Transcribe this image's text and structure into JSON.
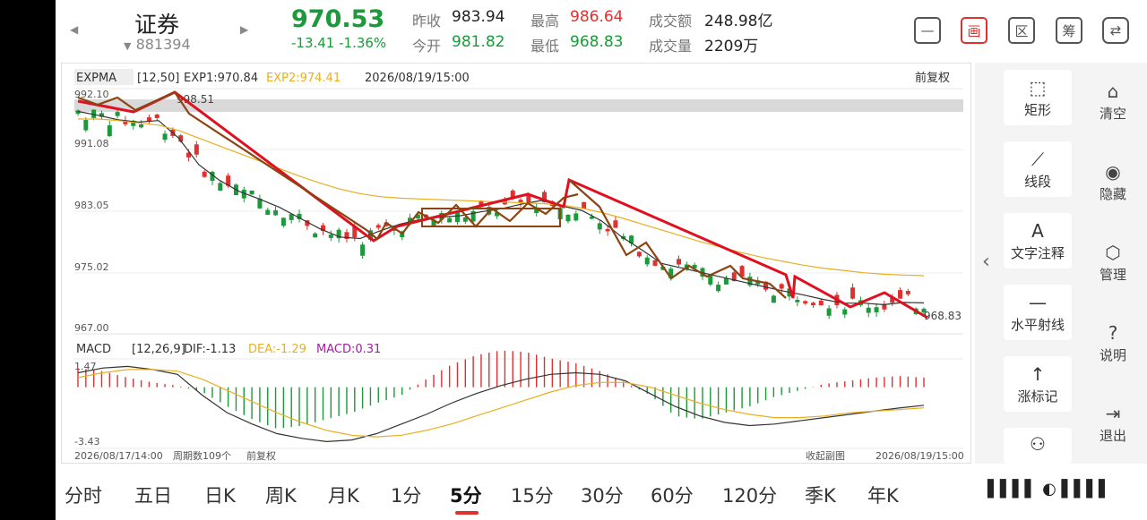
{
  "header": {
    "name": "证券",
    "code": "881394",
    "price": "970.53",
    "change": "-13.41  -1.36%",
    "quotes": [
      {
        "label": "昨收",
        "value": "983.94"
      },
      {
        "label": "今开",
        "value": "981.82"
      },
      {
        "label": "最高",
        "value": "986.64"
      },
      {
        "label": "最低",
        "value": "968.83"
      },
      {
        "label": "成交额",
        "value": "248.98亿"
      },
      {
        "label": "成交量",
        "value": "2209万"
      }
    ],
    "icons": [
      "minus-box-icon",
      "draw-icon",
      "region-icon",
      "chip-icon",
      "switch-device-icon"
    ],
    "icon_glyphs": [
      "—",
      "画",
      "区",
      "筹",
      "⇄"
    ]
  },
  "chart": {
    "expma_label": "EXPMA",
    "expma_params": "[12,50]",
    "exp1": "EXP1:970.84",
    "exp2": "EXP2:974.41",
    "datetime": "2026/08/19/15:00",
    "adjust": "前复权",
    "y_ticks": [
      "991.08",
      "983.05",
      "975.02",
      "967.00"
    ],
    "top_label": "998.51",
    "top_label_left": "992.10",
    "last_label": "968.83",
    "macd_label": "MACD",
    "macd_params": "[12,26,9]",
    "dif": "DIF:-1.13",
    "dea": "DEA:-1.29",
    "macd_val": "MACD:0.31",
    "macd_top": "1.47",
    "macd_bottom": "-3.43",
    "start_time": "2026/08/17/14:00",
    "period_count": "周期数109个",
    "adjust_bottom": "前复权",
    "fold_sub": "收起副图",
    "end_time": "2026/08/19/15:00",
    "colors": {
      "up": "#e03030",
      "down": "#1a9a3a",
      "exp1": "#333333",
      "exp2": "#e8b020",
      "draw": "#8b4513",
      "trend": "#e01020"
    }
  },
  "chart_data": {
    "type": "line",
    "title": "",
    "ylim": [
      967.0,
      999.0
    ],
    "series": [
      {
        "name": "EXP1",
        "values": [
          996.0,
          995.5,
          994.9,
          994.6,
          994.8,
          992.5,
          989.0,
          987.0,
          985.5,
          984.5,
          983.4,
          982.0,
          980.6,
          979.5,
          979.3,
          980.3,
          981.2,
          981.8,
          982.1,
          982.3,
          982.8,
          983.2,
          983.8,
          984.3,
          983.6,
          983.0,
          981.6,
          979.5,
          977.8,
          976.0,
          975.4,
          974.8,
          974.2,
          973.6,
          973.0,
          972.4,
          971.9,
          971.3,
          970.8,
          970.8,
          970.6,
          970.9,
          970.84
        ]
      },
      {
        "name": "EXP2",
        "values": [
          995.0,
          995.0,
          994.8,
          994.5,
          994.2,
          993.5,
          992.5,
          991.5,
          990.5,
          989.5,
          988.5,
          987.5,
          986.6,
          985.8,
          985.2,
          984.8,
          984.6,
          984.5,
          984.4,
          984.3,
          984.2,
          984.1,
          984.0,
          983.9,
          983.7,
          983.3,
          982.7,
          982.0,
          981.2,
          980.4,
          979.6,
          978.8,
          978.1,
          977.4,
          976.8,
          976.3,
          975.8,
          975.4,
          975.1,
          974.8,
          974.6,
          974.5,
          974.41
        ]
      }
    ],
    "macd": {
      "dif": [
        0.9,
        1.2,
        1.3,
        1.1,
        0.8,
        -0.5,
        -1.6,
        -2.3,
        -2.9,
        -3.2,
        -3.4,
        -3.3,
        -2.9,
        -2.3,
        -1.7,
        -1.0,
        -0.4,
        0.1,
        0.5,
        0.8,
        0.9,
        0.8,
        0.4,
        -0.4,
        -1.2,
        -1.8,
        -2.2,
        -2.4,
        -2.3,
        -2.1,
        -1.9,
        -1.7,
        -1.5,
        -1.3,
        -1.13
      ],
      "dea": [
        0.6,
        0.9,
        1.1,
        1.1,
        1.0,
        0.5,
        -0.2,
        -0.9,
        -1.6,
        -2.2,
        -2.7,
        -3.0,
        -3.1,
        -3.0,
        -2.7,
        -2.3,
        -1.8,
        -1.3,
        -0.8,
        -0.3,
        0.1,
        0.3,
        0.3,
        0.0,
        -0.5,
        -1.0,
        -1.4,
        -1.7,
        -1.9,
        -1.9,
        -1.8,
        -1.6,
        -1.5,
        -1.4,
        -1.29
      ],
      "hist": [
        1.2,
        1.0,
        0.6,
        0.3,
        0.1,
        -0.3,
        -1.2,
        -2.0,
        -2.6,
        -2.4,
        -2.0,
        -1.6,
        -1.0,
        -0.5,
        0.5,
        1.4,
        2.0,
        2.3,
        2.2,
        1.8,
        1.5,
        1.0,
        0.3,
        -0.5,
        -1.8,
        -2.0,
        -1.6,
        -1.2,
        -0.6,
        -0.2,
        0.2,
        0.4,
        0.6,
        0.7,
        0.6
      ]
    }
  },
  "tools": {
    "left": [
      {
        "icon": "rectangle-icon",
        "glyph": "⬚",
        "label": "矩形"
      },
      {
        "icon": "line-segment-icon",
        "glyph": "⟋",
        "label": "线段"
      },
      {
        "icon": "text-annotation-icon",
        "glyph": "A",
        "label": "文字注释"
      },
      {
        "icon": "horizontal-ray-icon",
        "glyph": "—",
        "label": "水平射线"
      },
      {
        "icon": "up-mark-icon",
        "glyph": "↑",
        "label": "涨标记"
      }
    ],
    "right": [
      {
        "icon": "clear-icon",
        "glyph": "⌂",
        "label": "清空"
      },
      {
        "icon": "hide-icon",
        "glyph": "◉",
        "label": "隐藏"
      },
      {
        "icon": "manage-icon",
        "glyph": "⬡",
        "label": "管理"
      },
      {
        "icon": "help-icon",
        "glyph": "?",
        "label": "说明"
      },
      {
        "icon": "exit-icon",
        "glyph": "⇥",
        "label": "退出"
      }
    ]
  },
  "tabs": [
    "分时",
    "五日",
    "日K",
    "周K",
    "月K",
    "1分",
    "5分",
    "15分",
    "30分",
    "60分",
    "120分",
    "季K",
    "年K"
  ],
  "active_tab": "5分"
}
